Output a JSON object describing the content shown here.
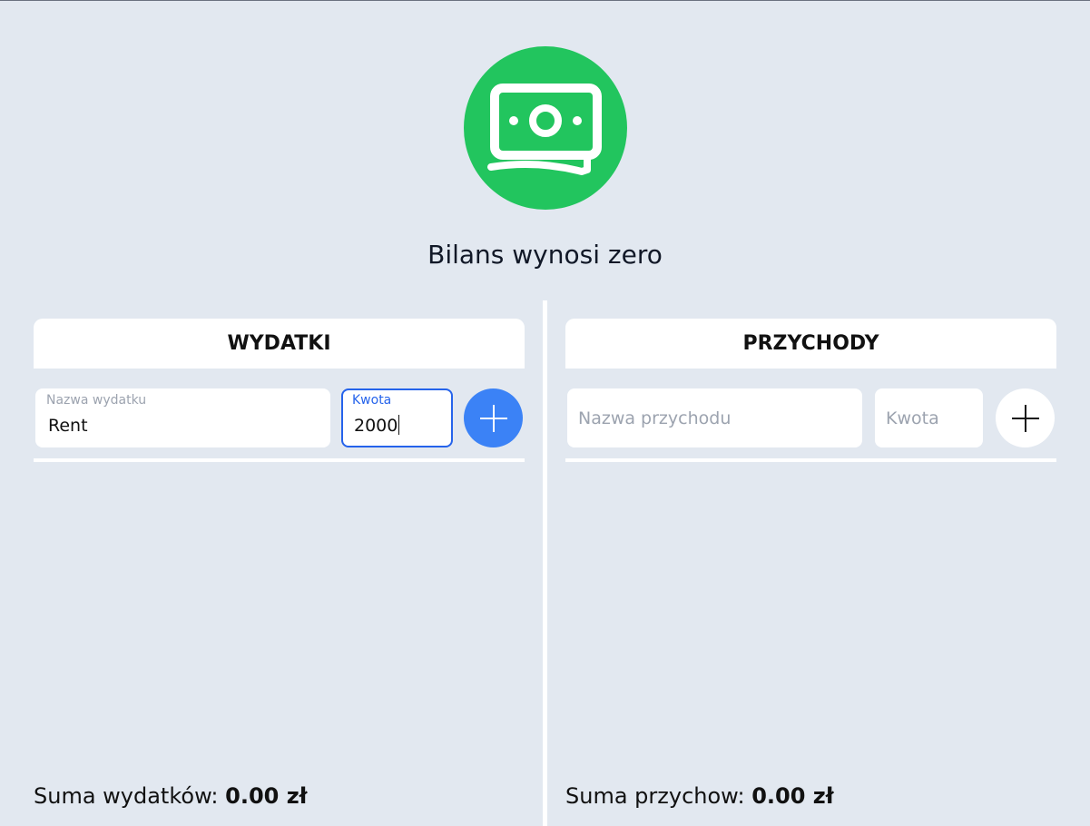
{
  "balance_text": "Bilans wynosi zero",
  "logo": {
    "icon": "money-bill-icon",
    "color": "#22c55e"
  },
  "expenses": {
    "title": "WYDATKI",
    "name_field": {
      "label": "Nazwa wydatku",
      "value": "Rent"
    },
    "amount_field": {
      "label": "Kwota",
      "value": "2000"
    },
    "add_button_color": "#3b82f6",
    "sum_label": "Suma wydatków:",
    "sum_value": "0.00 zł"
  },
  "income": {
    "title": "PRZYCHODY",
    "name_field": {
      "placeholder": "Nazwa przychodu",
      "value": ""
    },
    "amount_field": {
      "placeholder": "Kwota",
      "value": ""
    },
    "add_button_color": "#ffffff",
    "sum_label": "Suma przychow:",
    "sum_value": "0.00 zł"
  }
}
